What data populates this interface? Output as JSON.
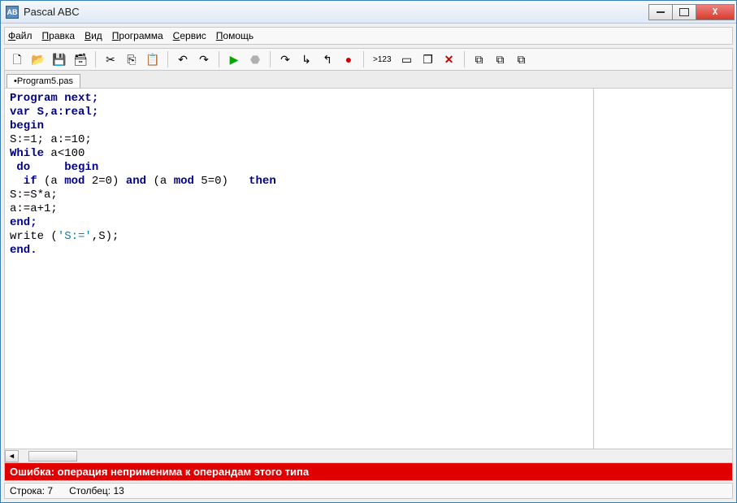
{
  "window": {
    "title": "Pascal ABC"
  },
  "menu": {
    "file": "Файл",
    "edit": "Правка",
    "view": "Вид",
    "program": "Программа",
    "service": "Сервис",
    "help": "Помощь"
  },
  "tab": {
    "label": "•Program5.pas"
  },
  "code": {
    "l1": "Program next;",
    "l2": "var S,a:real;",
    "l3": "begin",
    "l4": "S:=1; a:=10;",
    "l5a": "While",
    "l5b": " a<100",
    "l6a": " do",
    "l6b": "     begin",
    "l7a": "  if",
    "l7b": " (a ",
    "l7m1": "mod",
    "l7c": " 2=0) ",
    "l7and": "and",
    "l7d": " (a ",
    "l7m2": "mod",
    "l7e": " 5=0)   ",
    "l7then": "then",
    "l8": "S:=S*a;",
    "l9": "a:=a+1;",
    "l10": "end;",
    "l11a": "write (",
    "l11s": "'S:='",
    "l11b": ",S);",
    "l12": "end."
  },
  "error": {
    "text": "Ошибка: операция неприменима к операндам этого типа"
  },
  "status": {
    "row_label": "Строка:",
    "row": "7",
    "col_label": "Столбец:",
    "col": "13"
  },
  "icons": {
    "new": "🗋",
    "open": "📂",
    "save": "💾",
    "saveall": "🗃",
    "cut": "✂",
    "copy": "⎘",
    "paste": "📋",
    "undo": "↶",
    "redo": "↷",
    "run": "▶",
    "stop": "⬣",
    "stepover": "↷",
    "stepinto": "↳",
    "stepout": "↰",
    "breakpoint": "●",
    "eval": ">123",
    "window1": "▭",
    "window2": "❐",
    "closewin": "✕",
    "panel1": "⧉",
    "panel2": "⧉",
    "panel3": "⧉"
  }
}
